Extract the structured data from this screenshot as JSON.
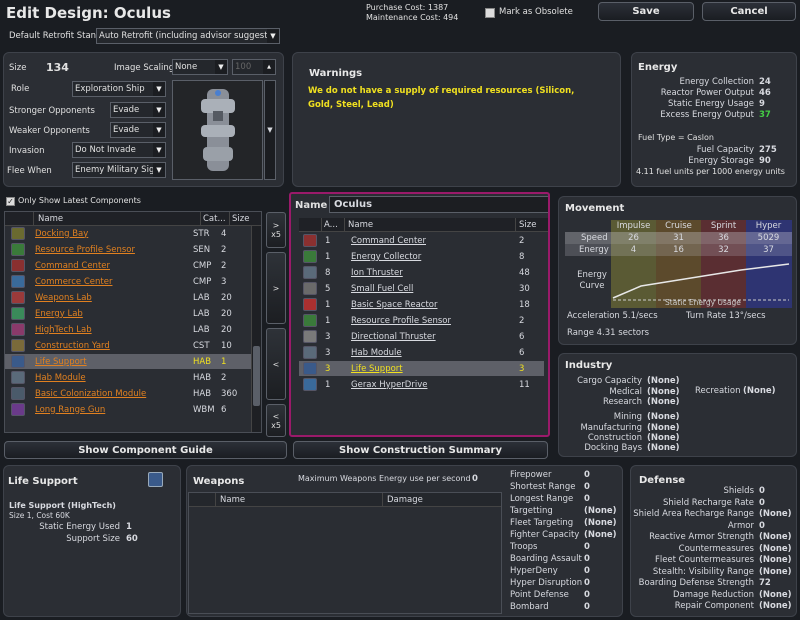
{
  "header": {
    "title": "Edit Design: Oculus",
    "purchase_cost": "Purchase Cost: 1387",
    "maintenance_cost": "Maintenance Cost: 494",
    "mark_obsolete": "Mark as Obsolete",
    "save": "Save",
    "cancel": "Cancel"
  },
  "retrofit": {
    "label": "Default Retrofit Stance",
    "value": "Auto Retrofit (including advisor suggestions)"
  },
  "design": {
    "size_label": "Size",
    "size_value": "134",
    "image_scaling_label": "Image Scaling",
    "image_scaling_value": "None",
    "image_scaling_num": "100",
    "role_label": "Role",
    "role_value": "Exploration Ship",
    "stronger_label": "Stronger Opponents",
    "stronger_value": "Evade",
    "weaker_label": "Weaker Opponents",
    "weaker_value": "Evade",
    "invasion_label": "Invasion",
    "invasion_value": "Do Not Invade",
    "flee_label": "Flee When",
    "flee_value": "Enemy Military Sighted"
  },
  "warnings": {
    "title": "Warnings",
    "text": "We do not have a supply of required resources (Silicon, Gold, Steel, Lead)"
  },
  "energy": {
    "title": "Energy",
    "rows": [
      {
        "label": "Energy Collection",
        "value": "24"
      },
      {
        "label": "Reactor Power Output",
        "value": "46"
      },
      {
        "label": "Static Energy Usage",
        "value": "9"
      },
      {
        "label": "Excess Energy Output",
        "value": "37"
      }
    ],
    "fuel_type": "Fuel Type = Caslon",
    "fuel_rows": [
      {
        "label": "Fuel Capacity",
        "value": "275"
      },
      {
        "label": "Energy Storage",
        "value": "90"
      }
    ],
    "fuel_note": "4.11 fuel units per 1000 energy units",
    "excess_color": "#44cc44"
  },
  "components": {
    "only_latest": "Only Show Latest Components",
    "headers": [
      "Name",
      "Cat...",
      "Size"
    ],
    "rows": [
      {
        "name": "Docking Bay",
        "cat": "STR",
        "size": "4"
      },
      {
        "name": "Resource Profile Sensor",
        "cat": "SEN",
        "size": "2"
      },
      {
        "name": "Command Center",
        "cat": "CMP",
        "size": "2"
      },
      {
        "name": "Commerce Center",
        "cat": "CMP",
        "size": "3"
      },
      {
        "name": "Weapons Lab",
        "cat": "LAB",
        "size": "20"
      },
      {
        "name": "Energy Lab",
        "cat": "LAB",
        "size": "20"
      },
      {
        "name": "HighTech Lab",
        "cat": "LAB",
        "size": "20"
      },
      {
        "name": "Construction Yard",
        "cat": "CST",
        "size": "10"
      },
      {
        "name": "Life Support",
        "cat": "HAB",
        "size": "1"
      },
      {
        "name": "Hab Module",
        "cat": "HAB",
        "size": "2"
      },
      {
        "name": "Basic Colonization Module",
        "cat": "HAB",
        "size": "360"
      },
      {
        "name": "Long Range Gun",
        "cat": "WBM",
        "size": "6"
      }
    ],
    "show_guide": "Show Component Guide"
  },
  "move_buttons": {
    "add5": "x5",
    "add": ">",
    "remove": "<",
    "remove5": "x5"
  },
  "design_list": {
    "name_label": "Name",
    "name_value": "Oculus",
    "headers": [
      "A...",
      "Name",
      "Size"
    ],
    "rows": [
      {
        "count": "1",
        "name": "Command Center",
        "size": "2"
      },
      {
        "count": "1",
        "name": "Energy Collector",
        "size": "8"
      },
      {
        "count": "8",
        "name": "Ion Thruster",
        "size": "48"
      },
      {
        "count": "5",
        "name": "Small Fuel Cell",
        "size": "30"
      },
      {
        "count": "1",
        "name": "Basic Space Reactor",
        "size": "18"
      },
      {
        "count": "1",
        "name": "Resource Profile Sensor",
        "size": "2"
      },
      {
        "count": "3",
        "name": "Directional Thruster",
        "size": "6"
      },
      {
        "count": "3",
        "name": "Hab Module",
        "size": "6"
      },
      {
        "count": "3",
        "name": "Life Support",
        "size": "3"
      },
      {
        "count": "1",
        "name": "Gerax HyperDrive",
        "size": "11"
      }
    ],
    "show_summary": "Show Construction Summary"
  },
  "movement": {
    "title": "Movement",
    "cols": [
      "Impulse",
      "Cruise",
      "Sprint",
      "Hyper"
    ],
    "speed_label": "Speed",
    "speed": [
      "26",
      "31",
      "36",
      "5029"
    ],
    "energy_label": "Energy",
    "energy": [
      "4",
      "16",
      "32",
      "37"
    ],
    "curve_label": "Energy Curve",
    "static_label": "Static Energy Usage",
    "acceleration": "Acceleration 5.1/secs",
    "turn_rate": "Turn Rate 13°/secs",
    "range": "Range 4.31 sectors"
  },
  "industry": {
    "title": "Industry",
    "left": [
      {
        "label": "Cargo Capacity",
        "value": "(None)"
      },
      {
        "label": "Medical",
        "value": "(None)"
      },
      {
        "label": "Research",
        "value": "(None)"
      },
      {
        "label": "Mining",
        "value": "(None)"
      },
      {
        "label": "Manufacturing",
        "value": "(None)"
      },
      {
        "label": "Construction",
        "value": "(None)"
      },
      {
        "label": "Docking Bays",
        "value": "(None)"
      }
    ],
    "recreation_label": "Recreation",
    "recreation_value": "(None)"
  },
  "life_support": {
    "title": "Life Support",
    "subtitle": "Life Support (HighTech)",
    "cost": "Size 1, Cost 60K",
    "rows": [
      {
        "label": "Static Energy Used",
        "value": "1"
      },
      {
        "label": "Support Size",
        "value": "60"
      }
    ]
  },
  "weapons": {
    "title": "Weapons",
    "max_energy_label": "Maximum Weapons Energy use per second",
    "max_energy_value": "0",
    "headers": [
      "Name",
      "Damage"
    ],
    "stats": [
      {
        "label": "Firepower",
        "value": "0"
      },
      {
        "label": "Shortest Range",
        "value": "0"
      },
      {
        "label": "Longest Range",
        "value": "0"
      },
      {
        "label": "Targetting",
        "value": "(None)"
      },
      {
        "label": "Fleet Targeting",
        "value": "(None)"
      },
      {
        "label": "Fighter Capacity",
        "value": "(None)"
      },
      {
        "label": "Troops",
        "value": "0"
      },
      {
        "label": "Boarding Assault",
        "value": "0"
      },
      {
        "label": "HyperDeny",
        "value": "0"
      },
      {
        "label": "Hyper Disruption",
        "value": "0"
      },
      {
        "label": "Point Defense",
        "value": "0"
      },
      {
        "label": "Bombard",
        "value": "0"
      }
    ]
  },
  "defense": {
    "title": "Defense",
    "rows": [
      {
        "label": "Shields",
        "value": "0"
      },
      {
        "label": "Shield Recharge Rate",
        "value": "0"
      },
      {
        "label": "Shield Area Recharge Range",
        "value": "(None)"
      },
      {
        "label": "Armor",
        "value": "0"
      },
      {
        "label": "Reactive Armor Strength",
        "value": "(None)"
      },
      {
        "label": "Countermeasures",
        "value": "(None)"
      },
      {
        "label": "Fleet Countermeasures",
        "value": "(None)"
      },
      {
        "label": "Stealth: Visibility Range",
        "value": "(None)"
      },
      {
        "label": "Boarding Defense Strength",
        "value": "72"
      },
      {
        "label": "Damage Reduction",
        "value": "(None)"
      },
      {
        "label": "Repair Component",
        "value": "(None)"
      }
    ]
  }
}
